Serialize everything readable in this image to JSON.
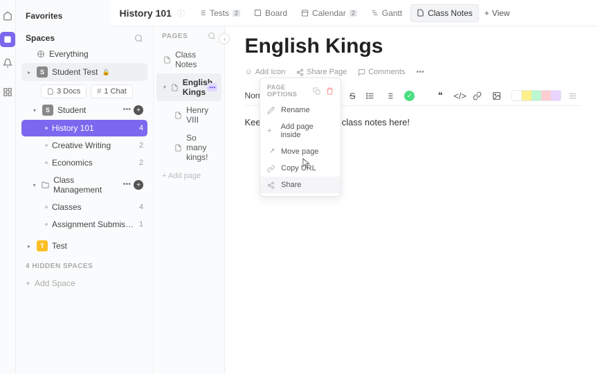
{
  "sidebar": {
    "favorites": "Favorites",
    "spaces": "Spaces",
    "everything": "Everything",
    "student_test": {
      "label": "Student Test",
      "badge": "S"
    },
    "docs_chip": "3 Docs",
    "chat_chip": "1 Chat",
    "student": {
      "label": "Student",
      "badge": "S"
    },
    "folders": {
      "history": {
        "label": "History 101",
        "count": "4"
      },
      "creative": {
        "label": "Creative Writing",
        "count": "2"
      },
      "economics": {
        "label": "Economics",
        "count": "2"
      },
      "class_mgmt": {
        "label": "Class Management"
      },
      "classes": {
        "label": "Classes",
        "count": "4"
      },
      "assignments": {
        "label": "Assignment Submissio...",
        "count": "1"
      }
    },
    "test": {
      "label": "Test",
      "badge": "T"
    },
    "hidden": "4 HIDDEN SPACES",
    "add_space": "Add Space"
  },
  "pages": {
    "header": "PAGES",
    "class_notes": "Class Notes",
    "english_kings": "English Kings",
    "henry": "Henry VIII",
    "so_many": "So many kings!",
    "add_page": "+ Add page"
  },
  "topbar": {
    "breadcrumb": "History 101",
    "tests": {
      "label": "Tests",
      "badge": "2"
    },
    "board": "Board",
    "calendar": {
      "label": "Calendar",
      "badge": "2"
    },
    "gantt": "Gantt",
    "class_notes": "Class Notes",
    "add_view": "View"
  },
  "doc": {
    "title": "English Kings",
    "add_icon": "Add Icon",
    "share_page": "Share Page",
    "comments": "Comments",
    "format": "Normal",
    "body": "Keep track of all of your class notes here!"
  },
  "menu": {
    "title": "PAGE OPTIONS",
    "rename": "Rename",
    "add_inside": "Add page inside",
    "move": "Move page",
    "copy_url": "Copy URL",
    "share": "Share"
  },
  "colors": {
    "swatches": [
      "#ffffff",
      "#fef08a",
      "#bbf7d0",
      "#fecdd3",
      "#e9d5ff"
    ]
  }
}
